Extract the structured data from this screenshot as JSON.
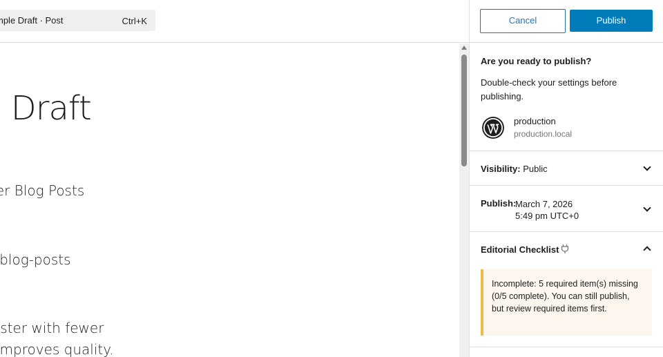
{
  "command_bar": {
    "title": "mple Draft · Post",
    "shortcut": "Ctrl+K"
  },
  "canvas": {
    "post_title": "e Draft",
    "blocks": [
      "ter Blog Posts",
      "-blog-posts",
      "aster with fewer",
      "improves quality."
    ]
  },
  "sidebar": {
    "cancel_label": "Cancel",
    "publish_label": "Publish",
    "ready_heading": "Are you ready to publish?",
    "ready_text": "Double-check your settings before publishing.",
    "site": {
      "icon": "wordpress-logo",
      "name": "production",
      "url": "production.local"
    },
    "visibility": {
      "label": "Visibility:",
      "value": "Public"
    },
    "publish_date": {
      "label": "Publish:",
      "line1": "March 7, 2026",
      "line2": "5:49 pm UTC+0"
    },
    "checklist": {
      "title": "Editorial Checklist",
      "notice": "Incomplete: 5 required item(s) missing (0/5 complete). You can still publish, but review required items first."
    }
  },
  "colors": {
    "accent": "#007cba",
    "notice_border": "#f0b849",
    "notice_bg": "#fcf6ee"
  }
}
